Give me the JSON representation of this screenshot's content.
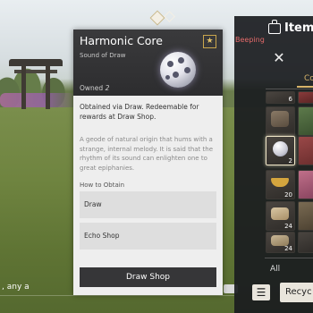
{
  "card": {
    "title": "Harmonic Core",
    "subtitle": "Sound of Draw",
    "owned_label": "Owned",
    "owned_count": "2",
    "description": "Obtained via Draw. Redeemable for rewards at Draw Shop.",
    "lore": "A geode of natural origin that hums with a strange, internal melody. It is said that the rhythm of its sound can enlighten one to great epiphanies.",
    "how_to_obtain": "How to Obtain",
    "sources": [
      "Draw",
      "Echo Shop"
    ],
    "action_button": "Draw Shop"
  },
  "inventory": {
    "title": "Item",
    "category_tab": "Co",
    "filter_label": "All",
    "recycle_button": "Recyc",
    "slot_counts": [
      "6",
      "",
      "",
      "2",
      "20",
      "24",
      "24"
    ]
  },
  "scene": {
    "map_hint": "Beeping",
    "bottom_text": ", any a"
  },
  "colors": {
    "accent_gold": "#d7b36a",
    "card_bg": "#eeeeee",
    "card_header": "#333335",
    "dark_panel": "#1a1c1f"
  },
  "icons": {
    "favorite": "star-icon",
    "bag": "bag-icon",
    "tools": "crossed-tools-icon",
    "sort": "sort-filter-icon"
  }
}
